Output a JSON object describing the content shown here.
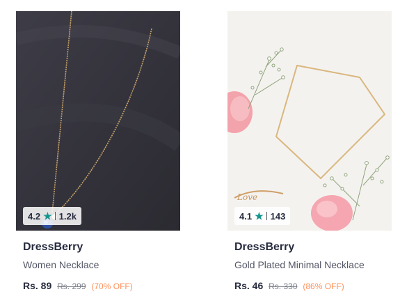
{
  "products": [
    {
      "brand": "DressBerry",
      "name": "Women Necklace",
      "rating": "4.2",
      "rating_count": "1.2k",
      "price": "Rs. 89",
      "mrp": "Rs. 299",
      "discount": "(70% OFF)",
      "image": "gold chain necklace with blue pendant on dark background"
    },
    {
      "brand": "DressBerry",
      "name": "Gold Plated Minimal Necklace",
      "rating": "4.1",
      "rating_count": "143",
      "price": "Rs. 46",
      "mrp": "Rs. 330",
      "discount": "(86% OFF)",
      "image": "gold minimal necklace with pink petals and baby's breath flowers"
    }
  ],
  "icons": {
    "rating": "star-icon"
  },
  "colors": {
    "star": "#14958f",
    "discount": "#ff905a",
    "brand_text": "#282c3f",
    "muted": "#7e818c"
  }
}
